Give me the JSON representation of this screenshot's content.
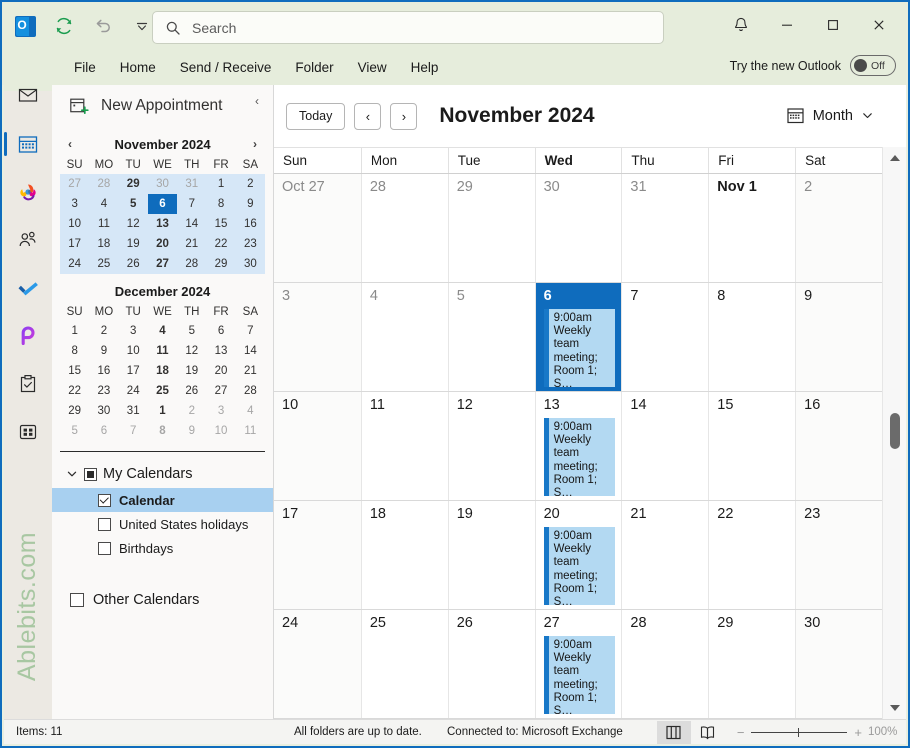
{
  "window": {
    "quick_access": [
      {
        "name": "outlook-logo",
        "label": "Outlook"
      },
      {
        "name": "send-receive-icon",
        "label": "Send/Receive All Folders"
      },
      {
        "name": "undo-icon",
        "label": "Undo"
      },
      {
        "name": "customize-qat-icon",
        "label": "Customize Quick Access Toolbar"
      }
    ],
    "search_placeholder": "Search",
    "controls": {
      "notifications": "Notifications",
      "minimize": "Minimize",
      "maximize": "Maximize",
      "close": "Close"
    }
  },
  "ribbon": {
    "tabs": [
      {
        "label": "File"
      },
      {
        "label": "Home"
      },
      {
        "label": "Send / Receive"
      },
      {
        "label": "Folder"
      },
      {
        "label": "View"
      },
      {
        "label": "Help"
      }
    ],
    "new_outlook_label": "Try the new Outlook",
    "new_outlook_state": "Off"
  },
  "rail": {
    "items": [
      {
        "name": "mail",
        "label": "Mail",
        "selected": false
      },
      {
        "name": "calendar",
        "label": "Calendar",
        "selected": true
      },
      {
        "name": "copilot",
        "label": "Copilot",
        "selected": false
      },
      {
        "name": "people",
        "label": "People",
        "selected": false
      },
      {
        "name": "todo",
        "label": "To Do",
        "selected": false
      },
      {
        "name": "viva-insights",
        "label": "Viva Insights",
        "selected": false
      },
      {
        "name": "tasks",
        "label": "Tasks",
        "selected": false
      },
      {
        "name": "more-apps",
        "label": "More apps",
        "selected": false
      }
    ],
    "watermark": "Ablebits.com"
  },
  "navpane": {
    "new_appointment_label": "New Appointment",
    "collapse_label": "‹",
    "minicals": [
      {
        "title": "November 2024",
        "weekdays": [
          "SU",
          "MO",
          "TU",
          "WE",
          "TH",
          "FR",
          "SA"
        ],
        "weeks": [
          [
            {
              "d": "27",
              "s": "dim"
            },
            {
              "d": "28",
              "s": "dim"
            },
            {
              "d": "29",
              "s": "bold"
            },
            {
              "d": "30",
              "s": "dim"
            },
            {
              "d": "31",
              "s": "dim"
            },
            {
              "d": "1",
              "s": ""
            },
            {
              "d": "2",
              "s": ""
            }
          ],
          [
            {
              "d": "3",
              "s": ""
            },
            {
              "d": "4",
              "s": ""
            },
            {
              "d": "5",
              "s": "bold"
            },
            {
              "d": "6",
              "s": "sel"
            },
            {
              "d": "7",
              "s": ""
            },
            {
              "d": "8",
              "s": ""
            },
            {
              "d": "9",
              "s": ""
            }
          ],
          [
            {
              "d": "10",
              "s": ""
            },
            {
              "d": "11",
              "s": ""
            },
            {
              "d": "12",
              "s": ""
            },
            {
              "d": "13",
              "s": "bold"
            },
            {
              "d": "14",
              "s": ""
            },
            {
              "d": "15",
              "s": ""
            },
            {
              "d": "16",
              "s": ""
            }
          ],
          [
            {
              "d": "17",
              "s": ""
            },
            {
              "d": "18",
              "s": ""
            },
            {
              "d": "19",
              "s": ""
            },
            {
              "d": "20",
              "s": "bold"
            },
            {
              "d": "21",
              "s": ""
            },
            {
              "d": "22",
              "s": ""
            },
            {
              "d": "23",
              "s": ""
            }
          ],
          [
            {
              "d": "24",
              "s": ""
            },
            {
              "d": "25",
              "s": ""
            },
            {
              "d": "26",
              "s": ""
            },
            {
              "d": "27",
              "s": "bold"
            },
            {
              "d": "28",
              "s": ""
            },
            {
              "d": "29",
              "s": ""
            },
            {
              "d": "30",
              "s": ""
            }
          ]
        ],
        "banded": true,
        "has_nav": true
      },
      {
        "title": "December 2024",
        "weekdays": [
          "SU",
          "MO",
          "TU",
          "WE",
          "TH",
          "FR",
          "SA"
        ],
        "weeks": [
          [
            {
              "d": "1",
              "s": ""
            },
            {
              "d": "2",
              "s": ""
            },
            {
              "d": "3",
              "s": ""
            },
            {
              "d": "4",
              "s": "bold"
            },
            {
              "d": "5",
              "s": ""
            },
            {
              "d": "6",
              "s": ""
            },
            {
              "d": "7",
              "s": ""
            }
          ],
          [
            {
              "d": "8",
              "s": ""
            },
            {
              "d": "9",
              "s": ""
            },
            {
              "d": "10",
              "s": ""
            },
            {
              "d": "11",
              "s": "bold"
            },
            {
              "d": "12",
              "s": ""
            },
            {
              "d": "13",
              "s": ""
            },
            {
              "d": "14",
              "s": ""
            }
          ],
          [
            {
              "d": "15",
              "s": ""
            },
            {
              "d": "16",
              "s": ""
            },
            {
              "d": "17",
              "s": ""
            },
            {
              "d": "18",
              "s": "bold"
            },
            {
              "d": "19",
              "s": ""
            },
            {
              "d": "20",
              "s": ""
            },
            {
              "d": "21",
              "s": ""
            }
          ],
          [
            {
              "d": "22",
              "s": ""
            },
            {
              "d": "23",
              "s": ""
            },
            {
              "d": "24",
              "s": ""
            },
            {
              "d": "25",
              "s": "bold"
            },
            {
              "d": "26",
              "s": ""
            },
            {
              "d": "27",
              "s": ""
            },
            {
              "d": "28",
              "s": ""
            }
          ],
          [
            {
              "d": "29",
              "s": ""
            },
            {
              "d": "30",
              "s": ""
            },
            {
              "d": "31",
              "s": ""
            },
            {
              "d": "1",
              "s": "bold"
            },
            {
              "d": "2",
              "s": "dim"
            },
            {
              "d": "3",
              "s": "dim"
            },
            {
              "d": "4",
              "s": "dim"
            }
          ],
          [
            {
              "d": "5",
              "s": "dim"
            },
            {
              "d": "6",
              "s": "dim"
            },
            {
              "d": "7",
              "s": "dim"
            },
            {
              "d": "8",
              "s": "dimbold"
            },
            {
              "d": "9",
              "s": "dim"
            },
            {
              "d": "10",
              "s": "dim"
            },
            {
              "d": "11",
              "s": "dim"
            }
          ]
        ],
        "banded": false,
        "has_nav": false
      }
    ],
    "my_calendars": {
      "group_label": "My Calendars",
      "expanded": true,
      "items": [
        {
          "label": "Calendar",
          "checked": true,
          "active": true
        },
        {
          "label": "United States holidays",
          "checked": false,
          "active": false
        },
        {
          "label": "Birthdays",
          "checked": false,
          "active": false
        }
      ]
    },
    "other_calendars": {
      "label": "Other Calendars",
      "checked": false
    }
  },
  "calendar": {
    "toolbar": {
      "today_label": "Today",
      "prev_label": "‹",
      "next_label": "›",
      "title": "November 2024",
      "view_label": "Month",
      "view_chevron": "⌄"
    },
    "weekday_headers": [
      {
        "label": "Sun",
        "bold": false
      },
      {
        "label": "Mon",
        "bold": false
      },
      {
        "label": "Tue",
        "bold": false
      },
      {
        "label": "Wed",
        "bold": true
      },
      {
        "label": "Thu",
        "bold": false
      },
      {
        "label": "Fri",
        "bold": false
      },
      {
        "label": "Sat",
        "bold": false
      }
    ],
    "weeks": [
      [
        {
          "day": "Oct 27",
          "state": "dim",
          "weekend": true,
          "events": []
        },
        {
          "day": "28",
          "state": "dim",
          "weekend": false,
          "events": []
        },
        {
          "day": "29",
          "state": "dim",
          "weekend": false,
          "events": []
        },
        {
          "day": "30",
          "state": "dim",
          "weekend": false,
          "events": []
        },
        {
          "day": "31",
          "state": "dim",
          "weekend": false,
          "events": []
        },
        {
          "day": "Nov 1",
          "state": "strong",
          "weekend": false,
          "events": []
        },
        {
          "day": "2",
          "state": "dim",
          "weekend": true,
          "events": []
        }
      ],
      [
        {
          "day": "3",
          "state": "dim",
          "weekend": true,
          "events": []
        },
        {
          "day": "4",
          "state": "dim",
          "weekend": false,
          "events": []
        },
        {
          "day": "5",
          "state": "dim",
          "weekend": false,
          "events": []
        },
        {
          "day": "6",
          "state": "selected",
          "weekend": false,
          "events": [
            {
              "text": "9:00am Weekly team meeting; Room 1; S…"
            }
          ]
        },
        {
          "day": "7",
          "state": "normal",
          "weekend": false,
          "events": []
        },
        {
          "day": "8",
          "state": "normal",
          "weekend": false,
          "events": []
        },
        {
          "day": "9",
          "state": "normal",
          "weekend": true,
          "events": []
        }
      ],
      [
        {
          "day": "10",
          "state": "normal",
          "weekend": true,
          "events": []
        },
        {
          "day": "11",
          "state": "normal",
          "weekend": false,
          "events": []
        },
        {
          "day": "12",
          "state": "normal",
          "weekend": false,
          "events": []
        },
        {
          "day": "13",
          "state": "normal",
          "weekend": false,
          "events": [
            {
              "text": "9:00am Weekly team meeting; Room 1; S…"
            }
          ]
        },
        {
          "day": "14",
          "state": "normal",
          "weekend": false,
          "events": []
        },
        {
          "day": "15",
          "state": "normal",
          "weekend": false,
          "events": []
        },
        {
          "day": "16",
          "state": "normal",
          "weekend": true,
          "events": []
        }
      ],
      [
        {
          "day": "17",
          "state": "normal",
          "weekend": true,
          "events": []
        },
        {
          "day": "18",
          "state": "normal",
          "weekend": false,
          "events": []
        },
        {
          "day": "19",
          "state": "normal",
          "weekend": false,
          "events": []
        },
        {
          "day": "20",
          "state": "normal",
          "weekend": false,
          "events": [
            {
              "text": "9:00am Weekly team meeting; Room 1; S…"
            }
          ]
        },
        {
          "day": "21",
          "state": "normal",
          "weekend": false,
          "events": []
        },
        {
          "day": "22",
          "state": "normal",
          "weekend": false,
          "events": []
        },
        {
          "day": "23",
          "state": "normal",
          "weekend": true,
          "events": []
        }
      ],
      [
        {
          "day": "24",
          "state": "normal",
          "weekend": true,
          "events": []
        },
        {
          "day": "25",
          "state": "normal",
          "weekend": false,
          "events": []
        },
        {
          "day": "26",
          "state": "normal",
          "weekend": false,
          "events": []
        },
        {
          "day": "27",
          "state": "normal",
          "weekend": false,
          "events": [
            {
              "text": "9:00am Weekly team meeting; Room 1; S…"
            }
          ]
        },
        {
          "day": "28",
          "state": "normal",
          "weekend": false,
          "events": []
        },
        {
          "day": "29",
          "state": "normal",
          "weekend": false,
          "events": []
        },
        {
          "day": "30",
          "state": "normal",
          "weekend": true,
          "events": []
        }
      ]
    ]
  },
  "statusbar": {
    "items": "Items: 11",
    "sync": "All folders are up to date.",
    "connection": "Connected to: Microsoft Exchange",
    "view_normal": "Normal",
    "view_reading": "Reading",
    "zoom_out": "−",
    "zoom_in": "+",
    "zoom_level": "100%"
  },
  "colors": {
    "accent": "#0f6cbd",
    "event_bg": "#b3d9f2",
    "event_accent": "#1878c8",
    "titlebar": "#e6eddc",
    "selection": "#a8d0f0"
  }
}
